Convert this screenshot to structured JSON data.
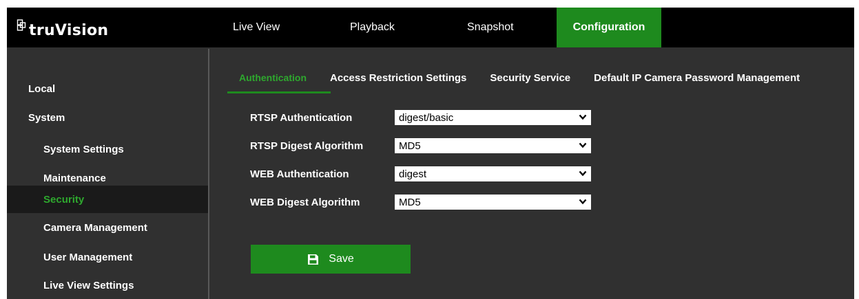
{
  "brand": {
    "name": "truVision",
    "logo_icon": "truvision-logo-icon"
  },
  "topnav": {
    "items": [
      {
        "label": "Live View",
        "active": false
      },
      {
        "label": "Playback",
        "active": false
      },
      {
        "label": "Snapshot",
        "active": false
      },
      {
        "label": "Configuration",
        "active": true
      }
    ]
  },
  "sidebar": {
    "items": [
      {
        "label": "Local",
        "level": 1,
        "active": false
      },
      {
        "label": "System",
        "level": 1,
        "active": false
      },
      {
        "label": "System Settings",
        "level": 2,
        "active": false
      },
      {
        "label": "Maintenance",
        "level": 2,
        "active": false
      },
      {
        "label": "Security",
        "level": 2,
        "active": true
      },
      {
        "label": "Camera Management",
        "level": 2,
        "active": false
      },
      {
        "label": "User Management",
        "level": 2,
        "active": false
      },
      {
        "label": "Live View Settings",
        "level": 2,
        "active": false
      }
    ]
  },
  "tabs": [
    {
      "label": "Authentication",
      "active": true
    },
    {
      "label": "Access Restriction Settings",
      "active": false
    },
    {
      "label": "Security Service",
      "active": false
    },
    {
      "label": "Default IP Camera Password Management",
      "active": false
    }
  ],
  "form": {
    "fields": [
      {
        "label": "RTSP Authentication",
        "value": "digest/basic"
      },
      {
        "label": "RTSP Digest Algorithm",
        "value": "MD5"
      },
      {
        "label": "WEB Authentication",
        "value": "digest"
      },
      {
        "label": "WEB Digest Algorithm",
        "value": "MD5"
      }
    ],
    "save": {
      "label": "Save",
      "icon": "floppy-disk-icon"
    }
  },
  "colors": {
    "accent": "#1e8a1e",
    "accent_text": "#2ea82e",
    "topbar_bg": "#000000",
    "panel_bg": "#303030",
    "active_side_bg": "#1a1a1a"
  }
}
